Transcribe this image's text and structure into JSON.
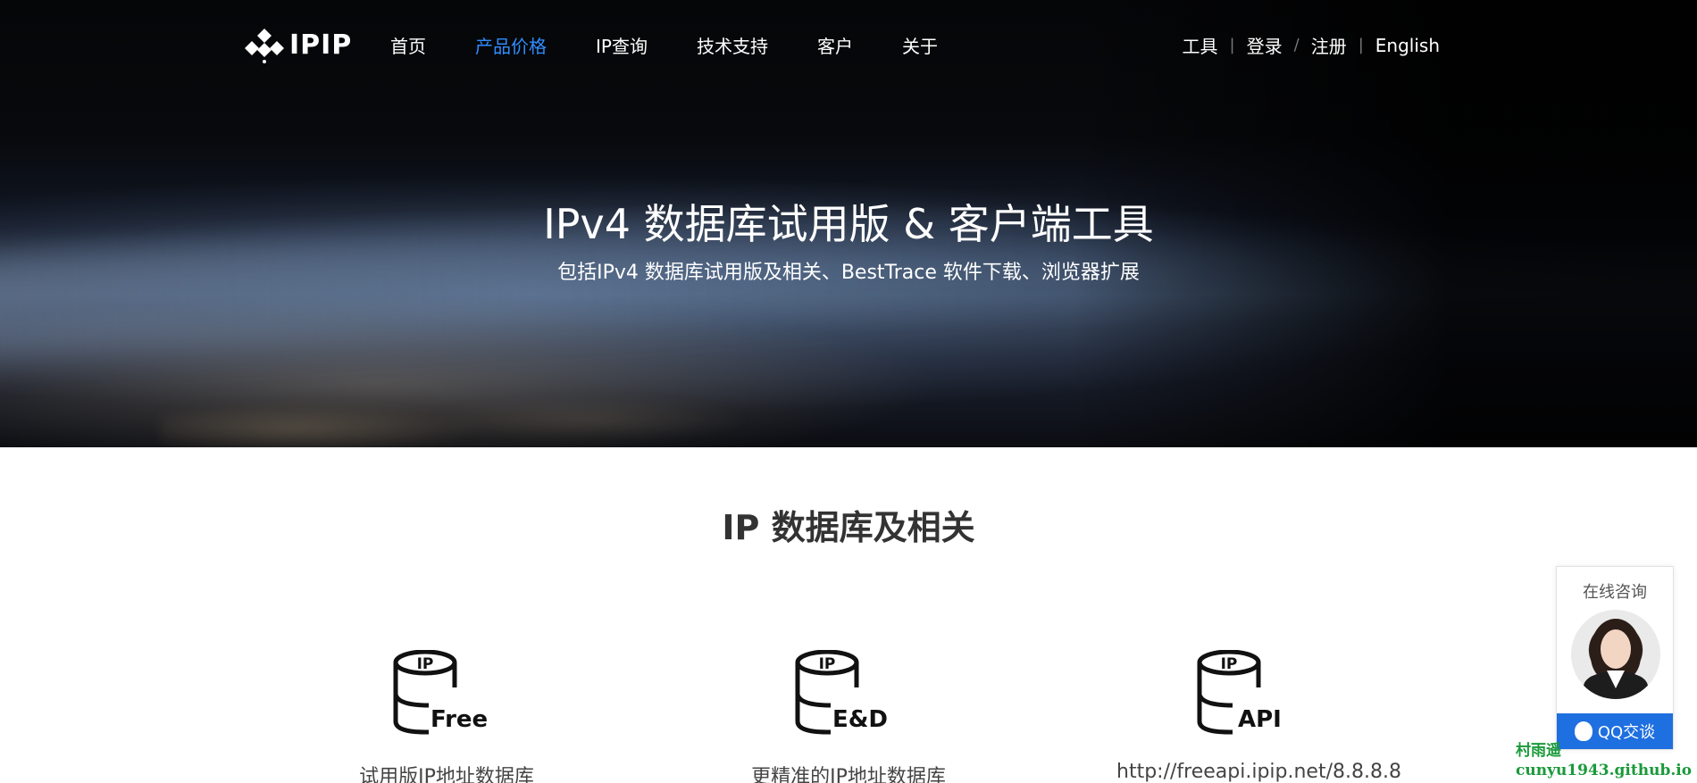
{
  "nav": {
    "logo_text": "IPIP",
    "items": [
      {
        "label": "首页",
        "active": false
      },
      {
        "label": "产品价格",
        "active": true
      },
      {
        "label": "IP查询",
        "active": false
      },
      {
        "label": "技术支持",
        "active": false
      },
      {
        "label": "客户",
        "active": false
      },
      {
        "label": "关于",
        "active": false
      }
    ],
    "right": {
      "tools": "工具",
      "login": "登录",
      "sep1": "|",
      "sep2": "/",
      "sep3": "|",
      "register": "注册",
      "english": "English"
    },
    "active_color": "#2f8dff"
  },
  "hero": {
    "title": "IPv4 数据库试用版 & 客户端工具",
    "subtitle": "包括IPv4 数据库试用版及相关、BestTrace 软件下载、浏览器扩展"
  },
  "section": {
    "title": "IP 数据库及相关",
    "cards": [
      {
        "icon": "database-free-icon",
        "icon_top": "IP",
        "icon_label": "Free",
        "desc": "试用版IP地址数据库"
      },
      {
        "icon": "database-ed-icon",
        "icon_top": "IP",
        "icon_label": "E&D",
        "desc": "更精准的IP地址数据库"
      },
      {
        "icon": "database-api-icon",
        "icon_top": "IP",
        "icon_label": "API",
        "desc": "http://freeapi.ipip.net/8.8.8.8"
      }
    ]
  },
  "consult": {
    "title": "在线咨询",
    "button": "QQ交谈",
    "button_color": "#1e6fe0"
  },
  "watermark": {
    "line1": "村雨遥",
    "line2": "cunyu1943.github.io"
  }
}
